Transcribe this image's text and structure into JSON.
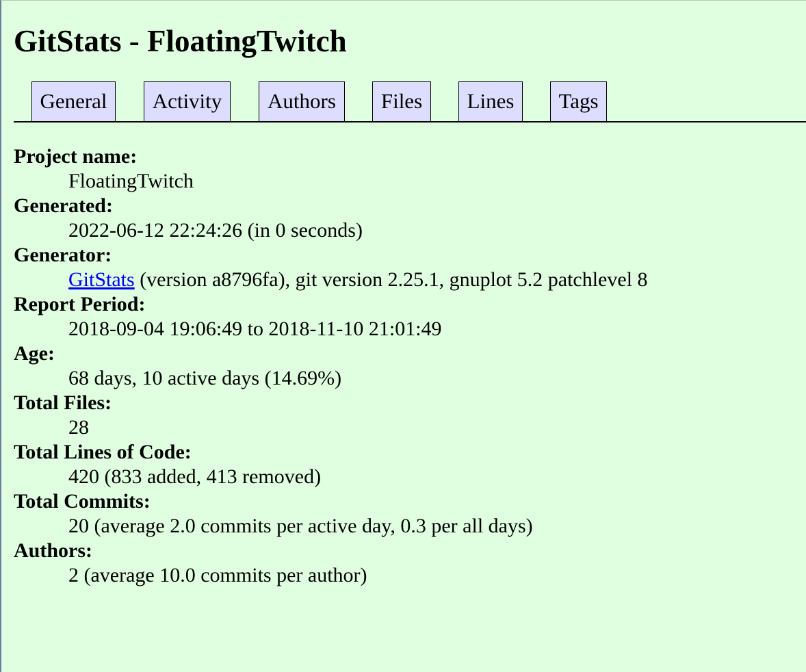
{
  "page": {
    "title": "GitStats - FloatingTwitch"
  },
  "nav": {
    "tabs": [
      {
        "label": "General"
      },
      {
        "label": "Activity"
      },
      {
        "label": "Authors"
      },
      {
        "label": "Files"
      },
      {
        "label": "Lines"
      },
      {
        "label": "Tags"
      }
    ]
  },
  "stats": {
    "project_name": {
      "label": "Project name:",
      "value": "FloatingTwitch"
    },
    "generated": {
      "label": "Generated:",
      "value": "2022-06-12 22:24:26 (in 0 seconds)"
    },
    "generator": {
      "label": "Generator:",
      "link_text": "GitStats",
      "value_rest": " (version a8796fa), git version 2.25.1, gnuplot 5.2 patchlevel 8"
    },
    "report_period": {
      "label": "Report Period:",
      "value": "2018-09-04 19:06:49 to 2018-11-10 21:01:49"
    },
    "age": {
      "label": "Age:",
      "value": "68 days, 10 active days (14.69%)"
    },
    "total_files": {
      "label": "Total Files:",
      "value": "28"
    },
    "total_lines": {
      "label": "Total Lines of Code:",
      "value": "420 (833 added, 413 removed)"
    },
    "total_commits": {
      "label": "Total Commits:",
      "value": "20 (average 2.0 commits per active day, 0.3 per all days)"
    },
    "authors": {
      "label": "Authors:",
      "value": "2 (average 10.0 commits per author)"
    }
  }
}
